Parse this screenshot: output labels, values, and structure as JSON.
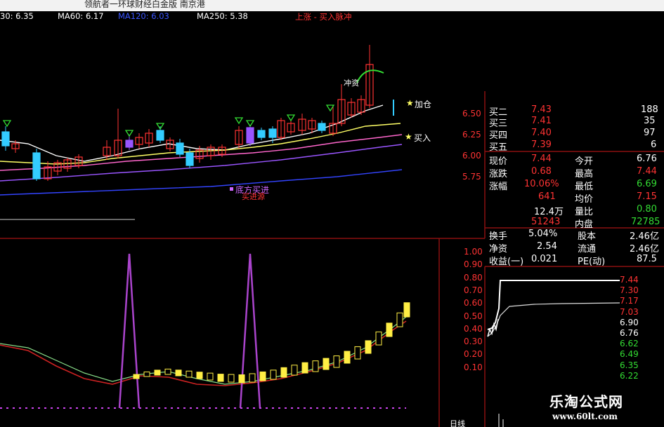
{
  "title_bar": {
    "text": "领航者一环球财经白金版  南京港"
  },
  "ma_bar": {
    "items": [
      {
        "label": "30: 6.35",
        "color": "#ffffff"
      },
      {
        "label": "MA60: 6.17",
        "color": "#ffffff"
      },
      {
        "label": "MA120: 6.03",
        "color": "#3a55ff"
      },
      {
        "label": "MA250: 5.38",
        "color": "#ffffff"
      },
      {
        "label": "上涨 - 买入脉冲",
        "color": "#ff3333"
      }
    ]
  },
  "chart_annotations": {
    "jiacang": "加仓",
    "mairu": "买入",
    "chong": "冲资",
    "legend_a": "底方买进",
    "legend_b": "买进源"
  },
  "price_axis_ticks": [
    "6.50",
    "6.25",
    "6.00",
    "5.75"
  ],
  "quote_panel": {
    "bids": [
      {
        "label": "买二",
        "price": "7.43",
        "vol": "188"
      },
      {
        "label": "买三",
        "price": "7.41",
        "vol": "35"
      },
      {
        "label": "买四",
        "price": "7.40",
        "vol": "97"
      },
      {
        "label": "买五",
        "price": "7.39",
        "vol": "6"
      }
    ],
    "stats": [
      {
        "l1": "现价",
        "v1": "7.44",
        "c1": "#ff3333",
        "l2": "今开",
        "v2": "6.76",
        "c2": "#ffffff"
      },
      {
        "l1": "涨跌",
        "v1": "0.68",
        "c1": "#ff3333",
        "l2": "最高",
        "v2": "7.44",
        "c2": "#ff3333"
      },
      {
        "l1": "涨幅",
        "v1": "10.06%",
        "c1": "#ff3333",
        "l2": "最低",
        "v2": "6.69",
        "c2": "#33dd33"
      },
      {
        "l1": "",
        "v1": "641",
        "c1": "#ff3333",
        "l2": "均价",
        "v2": "7.15",
        "c2": "#ff3333"
      },
      {
        "l1": "",
        "v1": "12.4万",
        "c1": "#ffffff",
        "l2": "量比",
        "v2": "0.80",
        "c2": "#33dd33"
      },
      {
        "l1": "",
        "v1": "51243",
        "c1": "#ff3333",
        "l2": "内盘",
        "v2": "72785",
        "c2": "#33dd33"
      }
    ],
    "fundamentals": [
      {
        "l1": "换手",
        "v1": "5.04%",
        "l2": "股本",
        "v2": "2.46亿"
      },
      {
        "l1": "净资",
        "v1": "2.54",
        "l2": "流通",
        "v2": "2.46亿"
      },
      {
        "l1": "收益(一)",
        "v1": "0.021",
        "l2": "PE(动)",
        "v2": "87.5"
      }
    ]
  },
  "indicator_axis_ticks": [
    "1.00",
    "0.90",
    "0.80",
    "0.70",
    "0.60",
    "0.50",
    "0.40",
    "0.30",
    "0.20",
    "0.10"
  ],
  "intraday_axis_ticks": [
    {
      "v": "7.44",
      "c": "#ff3333"
    },
    {
      "v": "7.30",
      "c": "#ff3333"
    },
    {
      "v": "7.17",
      "c": "#ff3333"
    },
    {
      "v": "7.03",
      "c": "#ff3333"
    },
    {
      "v": "6.90",
      "c": "#ffffff"
    },
    {
      "v": "6.76",
      "c": "#ffffff"
    },
    {
      "v": "6.62",
      "c": "#33dd33"
    },
    {
      "v": "6.49",
      "c": "#33dd33"
    },
    {
      "v": "6.35",
      "c": "#33dd33"
    },
    {
      "v": "6.22",
      "c": "#33dd33"
    }
  ],
  "bottom_label": "日线",
  "watermark": {
    "name": "乐淘公式网",
    "url": "www.60lt.com"
  }
}
